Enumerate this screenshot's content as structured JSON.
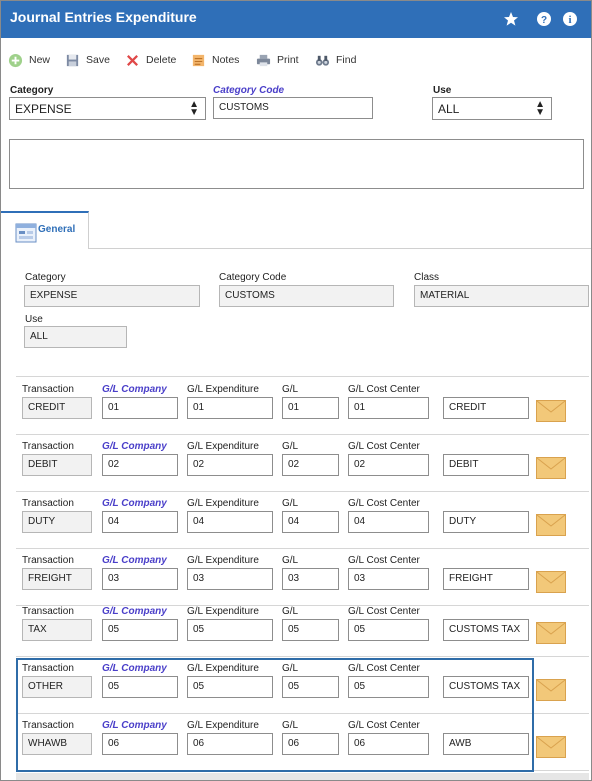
{
  "window": {
    "title": "Journal Entries Expenditure"
  },
  "title_icons": [
    "star-icon",
    "help-icon",
    "info-icon"
  ],
  "toolbar": {
    "new": "New",
    "save": "Save",
    "delete": "Delete",
    "notes": "Notes",
    "print": "Print",
    "find": "Find"
  },
  "header": {
    "category_label": "Category",
    "category_value": "EXPENSE",
    "category_code_label": "Category Code",
    "category_code_value": "CUSTOMS",
    "use_label": "Use",
    "use_value": "ALL"
  },
  "tabs": [
    {
      "label": "General"
    }
  ],
  "general": {
    "category_label": "Category",
    "category_value": "EXPENSE",
    "category_code_label": "Category Code",
    "category_code_value": "CUSTOMS",
    "class_label": "Class",
    "class_value": "MATERIAL",
    "use_label": "Use",
    "use_value": "ALL"
  },
  "grid": {
    "col_labels": {
      "transaction": "Transaction",
      "gl_company": "G/L Company",
      "gl_expenditure": "G/L Expenditure",
      "gl": "G/L",
      "gl_cost_center": "G/L Cost Center"
    },
    "rows": [
      {
        "transaction": "CREDIT",
        "gl_company": "01",
        "gl_expenditure": "01",
        "gl": "01",
        "gl_cost_center": "01",
        "description": "CREDIT"
      },
      {
        "transaction": "DEBIT",
        "gl_company": "02",
        "gl_expenditure": "02",
        "gl": "02",
        "gl_cost_center": "02",
        "description": "DEBIT"
      },
      {
        "transaction": "DUTY",
        "gl_company": "04",
        "gl_expenditure": "04",
        "gl": "04",
        "gl_cost_center": "04",
        "description": "DUTY"
      },
      {
        "transaction": "FREIGHT",
        "gl_company": "03",
        "gl_expenditure": "03",
        "gl": "03",
        "gl_cost_center": "03",
        "description": "FREIGHT"
      },
      {
        "transaction": "TAX",
        "gl_company": "05",
        "gl_expenditure": "05",
        "gl": "05",
        "gl_cost_center": "05",
        "description": "CUSTOMS TAX"
      },
      {
        "transaction": "OTHER",
        "gl_company": "05",
        "gl_expenditure": "05",
        "gl": "05",
        "gl_cost_center": "05",
        "description": "CUSTOMS TAX"
      },
      {
        "transaction": "WHAWB",
        "gl_company": "06",
        "gl_expenditure": "06",
        "gl": "06",
        "gl_cost_center": "06",
        "description": "AWB"
      }
    ]
  },
  "colors": {
    "accent": "#2f6fb8",
    "link": "#4a3fc9",
    "envelope": "#f2c879"
  }
}
